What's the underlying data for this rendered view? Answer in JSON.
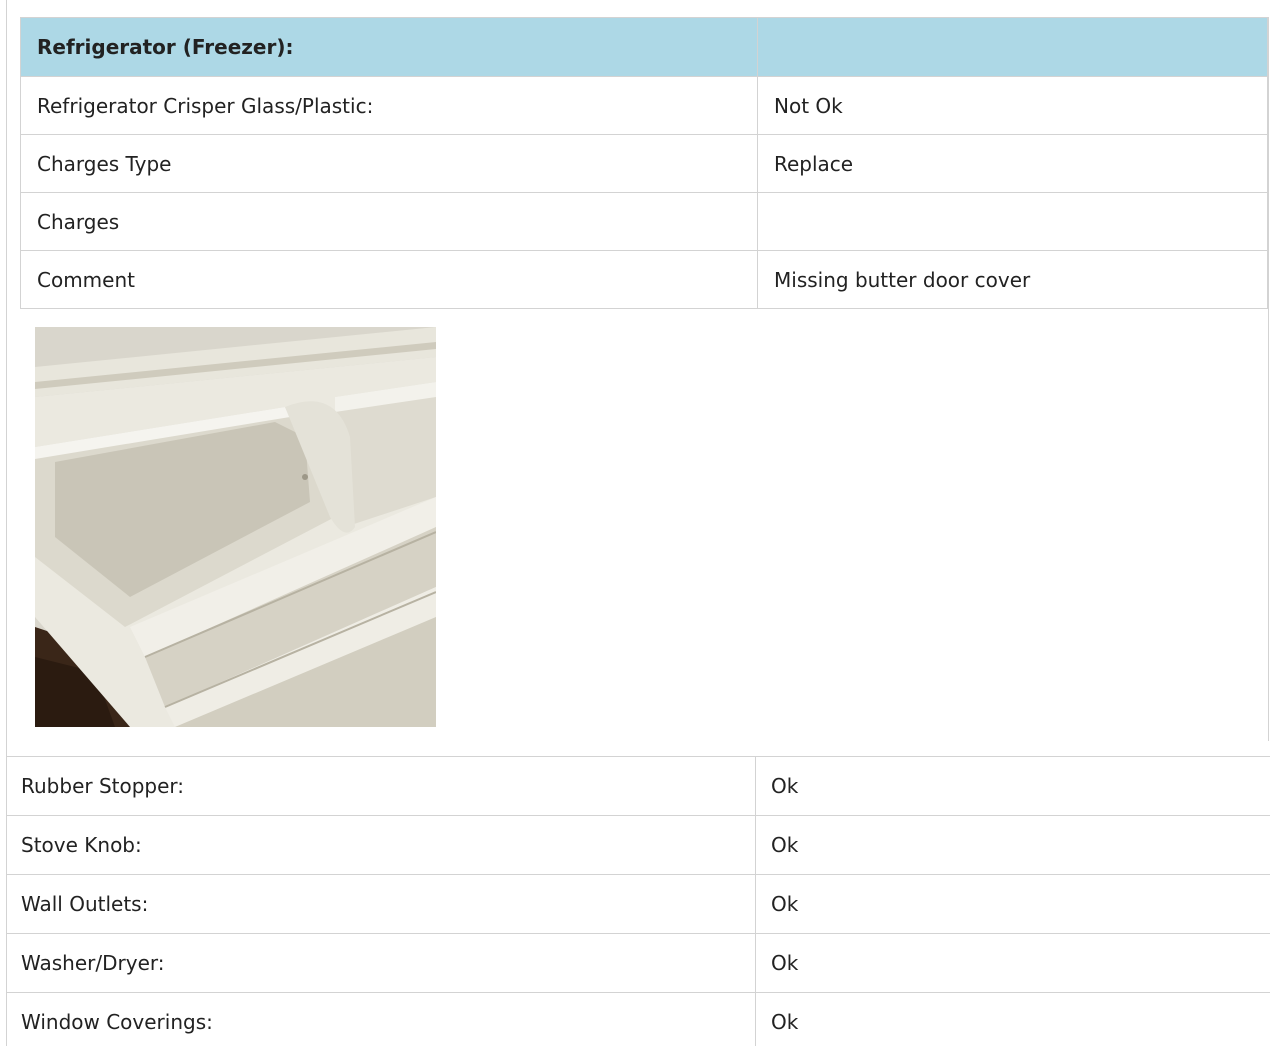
{
  "section": {
    "header_label": "Refrigerator (Freezer):",
    "header_value": "",
    "rows": [
      {
        "label": "Refrigerator Crisper Glass/Plastic:",
        "value": "Not Ok"
      },
      {
        "label": "Charges Type",
        "value": "Replace"
      },
      {
        "label": "Charges",
        "value": ""
      },
      {
        "label": "Comment",
        "value": "Missing butter door cover"
      }
    ]
  },
  "items": [
    {
      "label": "Rubber Stopper:",
      "value": "Ok"
    },
    {
      "label": "Stove Knob:",
      "value": "Ok"
    },
    {
      "label": "Wall Outlets:",
      "value": "Ok"
    },
    {
      "label": "Washer/Dryer:",
      "value": "Ok"
    },
    {
      "label": "Window Coverings:",
      "value": "Ok"
    }
  ],
  "colors": {
    "header_bg": "#add8e6",
    "border": "#d3d3d3",
    "text": "#222222"
  }
}
